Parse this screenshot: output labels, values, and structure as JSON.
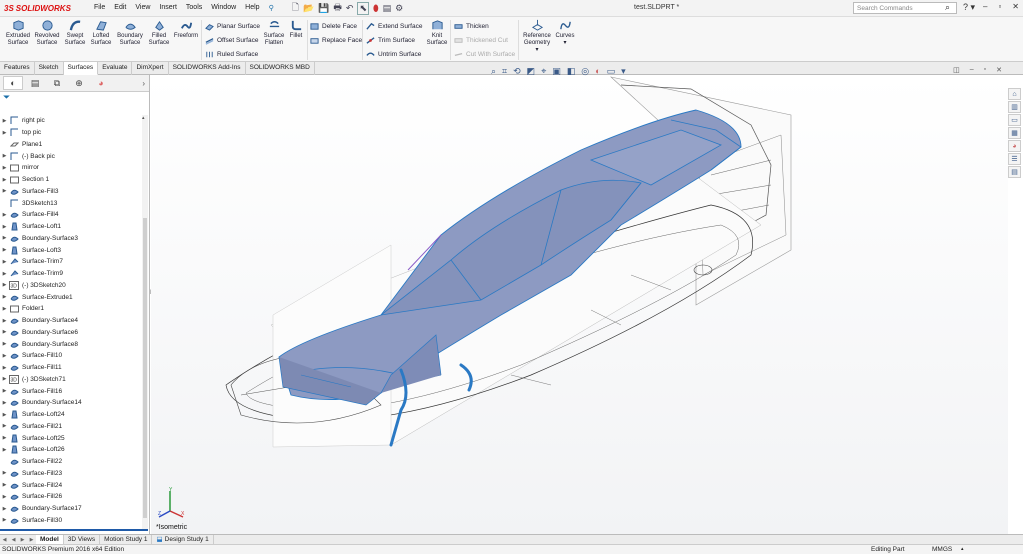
{
  "title": {
    "brand": "SOLIDWORKS",
    "menu": [
      "File",
      "Edit",
      "View",
      "Insert",
      "Tools",
      "Window",
      "Help"
    ],
    "document": "test.SLDPRT *",
    "search_placeholder": "Search Commands"
  },
  "ribbon": {
    "large": [
      "Extruded Surface",
      "Revolved Surface",
      "Swept Surface",
      "Lofted Surface",
      "Boundary Surface",
      "Filled Surface",
      "Freeform"
    ],
    "col1": [
      "Planar Surface",
      "Offset Surface",
      "Ruled Surface"
    ],
    "flatten": "Surface Flatten",
    "fillet": "Fillet",
    "col2": [
      "Delete Face",
      "Replace Face"
    ],
    "col3": [
      "Extend Surface",
      "Trim Surface",
      "Untrim Surface"
    ],
    "knit": "Knit Surface",
    "col4": [
      "Thicken",
      "Thickened Cut",
      "Cut With Surface"
    ],
    "refgeom": "Reference Geometry",
    "curves": "Curves"
  },
  "tabs": [
    "Features",
    "Sketch",
    "Surfaces",
    "Evaluate",
    "DimXpert",
    "SOLIDWORKS Add-Ins",
    "SOLIDWORKS MBD"
  ],
  "tree": [
    {
      "label": "right pic",
      "icon": "sketch-icon"
    },
    {
      "label": "top pic",
      "icon": "sketch-icon"
    },
    {
      "label": "Plane1",
      "icon": "plane-icon"
    },
    {
      "label": "(-) Back pic",
      "icon": "sketch-icon"
    },
    {
      "label": "mirror",
      "icon": "folder-icon"
    },
    {
      "label": "Section 1",
      "icon": "folder-icon"
    },
    {
      "label": "Surface-Fill3",
      "icon": "surface-icon"
    },
    {
      "label": "3DSketch13",
      "icon": "sketch-icon"
    },
    {
      "label": "Surface-Fill4",
      "icon": "surface-icon"
    },
    {
      "label": "Surface-Loft1",
      "icon": "loft-icon"
    },
    {
      "label": "Boundary-Surface3",
      "icon": "surface-icon"
    },
    {
      "label": "Surface-Loft3",
      "icon": "loft-icon"
    },
    {
      "label": "Surface-Trim7",
      "icon": "trim-icon"
    },
    {
      "label": "Surface-Trim9",
      "icon": "trim-icon"
    },
    {
      "label": "(-) 3DSketch20",
      "icon": "3dsketch-icon"
    },
    {
      "label": "Surface-Extrude1",
      "icon": "surface-icon"
    },
    {
      "label": "Folder1",
      "icon": "folder-icon"
    },
    {
      "label": "Boundary-Surface4",
      "icon": "surface-icon"
    },
    {
      "label": "Boundary-Surface6",
      "icon": "surface-icon"
    },
    {
      "label": "Boundary-Surface8",
      "icon": "surface-icon"
    },
    {
      "label": "Surface-Fill10",
      "icon": "surface-icon"
    },
    {
      "label": "Surface-Fill11",
      "icon": "surface-icon"
    },
    {
      "label": "(-) 3DSketch71",
      "icon": "3dsketch-icon"
    },
    {
      "label": "Surface-Fill16",
      "icon": "surface-icon"
    },
    {
      "label": "Boundary-Surface14",
      "icon": "surface-icon"
    },
    {
      "label": "Surface-Loft24",
      "icon": "loft-icon"
    },
    {
      "label": "Surface-Fill21",
      "icon": "surface-icon"
    },
    {
      "label": "Surface-Loft25",
      "icon": "loft-icon"
    },
    {
      "label": "Surface-Loft26",
      "icon": "loft-icon"
    },
    {
      "label": "Surface-Fill22",
      "icon": "surface-icon"
    },
    {
      "label": "Surface-Fill23",
      "icon": "surface-icon"
    },
    {
      "label": "Surface-Fill24",
      "icon": "surface-icon"
    },
    {
      "label": "Surface-Fill26",
      "icon": "surface-icon"
    },
    {
      "label": "Boundary-Surface17",
      "icon": "surface-icon"
    },
    {
      "label": "Surface-Fill30",
      "icon": "surface-icon"
    }
  ],
  "viewport": {
    "view_name": "*Isometric",
    "triad": {
      "x": "X",
      "y": "Y",
      "z": "Z"
    }
  },
  "bottom_tabs": [
    "Model",
    "3D Views",
    "Motion Study 1",
    "Design Study 1"
  ],
  "status": {
    "edition": "SOLIDWORKS Premium 2016 x64 Edition",
    "mode": "Editing Part",
    "units": "MMGS"
  },
  "colors": {
    "accent": "#1f5aa8",
    "surface": "#8d9ac2",
    "edge": "#2a79c4"
  }
}
